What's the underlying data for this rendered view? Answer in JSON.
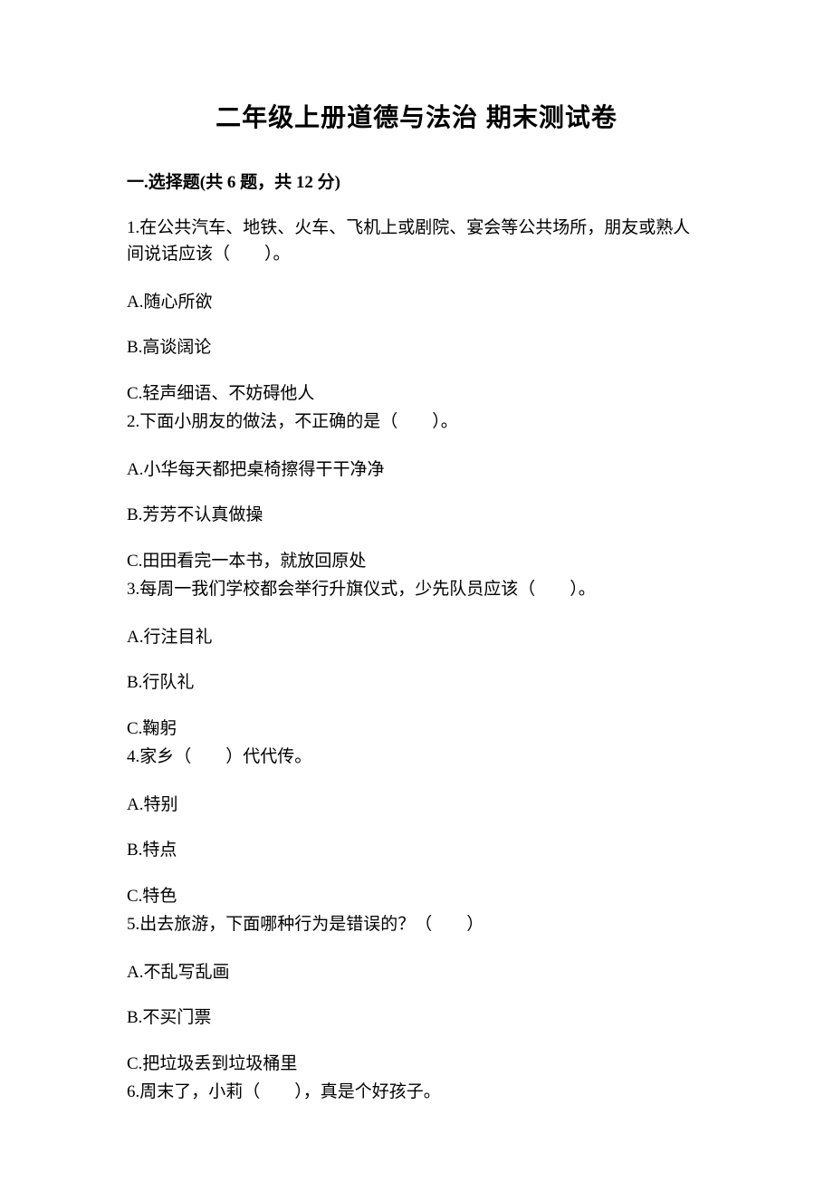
{
  "title": "二年级上册道德与法治 期末测试卷",
  "section": {
    "label": "一.选择题(共 6 题，共 12 分)"
  },
  "questions": [
    {
      "stem": "1.在公共汽车、地铁、火车、飞机上或剧院、宴会等公共场所，朋友或熟人间说话应该（　　）。",
      "options": [
        "A.随心所欲",
        "B.高谈阔论",
        "C.轻声细语、不妨碍他人"
      ]
    },
    {
      "stem": "2.下面小朋友的做法，不正确的是（　　）。",
      "options": [
        "A.小华每天都把桌椅擦得干干净净",
        "B.芳芳不认真做操",
        "C.田田看完一本书，就放回原处"
      ]
    },
    {
      "stem": "3.每周一我们学校都会举行升旗仪式，少先队员应该（　　）。",
      "options": [
        "A.行注目礼",
        "B.行队礼",
        "C.鞠躬"
      ]
    },
    {
      "stem": "4.家乡（　　）代代传。",
      "options": [
        "A.特别",
        "B.特点",
        "C.特色"
      ]
    },
    {
      "stem": "5.出去旅游，下面哪种行为是错误的？（　　）",
      "options": [
        "A.不乱写乱画",
        "B.不买门票",
        "C.把垃圾丢到垃圾桶里"
      ]
    },
    {
      "stem": "6.周末了，小莉（　　），真是个好孩子。",
      "options": []
    }
  ]
}
